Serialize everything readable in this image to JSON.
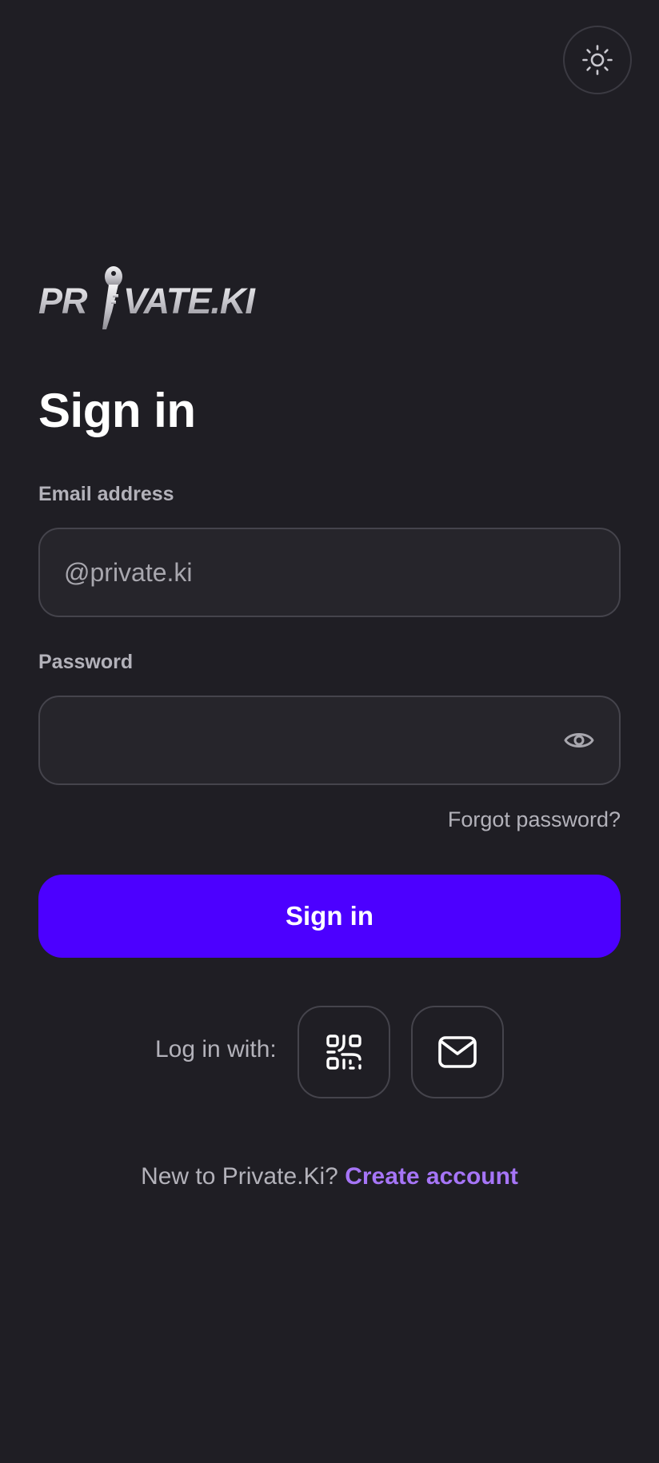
{
  "brand": {
    "logo_text": "PRIVATE.KI"
  },
  "header": {
    "theme_toggle_icon": "sun-icon"
  },
  "form": {
    "title": "Sign in",
    "email": {
      "label": "Email address",
      "value": "",
      "placeholder": "@private.ki"
    },
    "password": {
      "label": "Password",
      "value": "",
      "placeholder": "",
      "toggle_icon": "eye-icon"
    },
    "forgot_password": "Forgot password?",
    "submit_label": "Sign in"
  },
  "alt_login": {
    "label": "Log in with:",
    "options": [
      {
        "icon": "qr-code-icon"
      },
      {
        "icon": "envelope-icon"
      }
    ]
  },
  "footer": {
    "prompt": "New to Private.Ki?",
    "link": "Create account"
  },
  "colors": {
    "background": "#1f1e24",
    "primary": "#4c00ff",
    "link": "#a675f7",
    "muted_text": "#b3b2ba",
    "border": "#45444c"
  }
}
